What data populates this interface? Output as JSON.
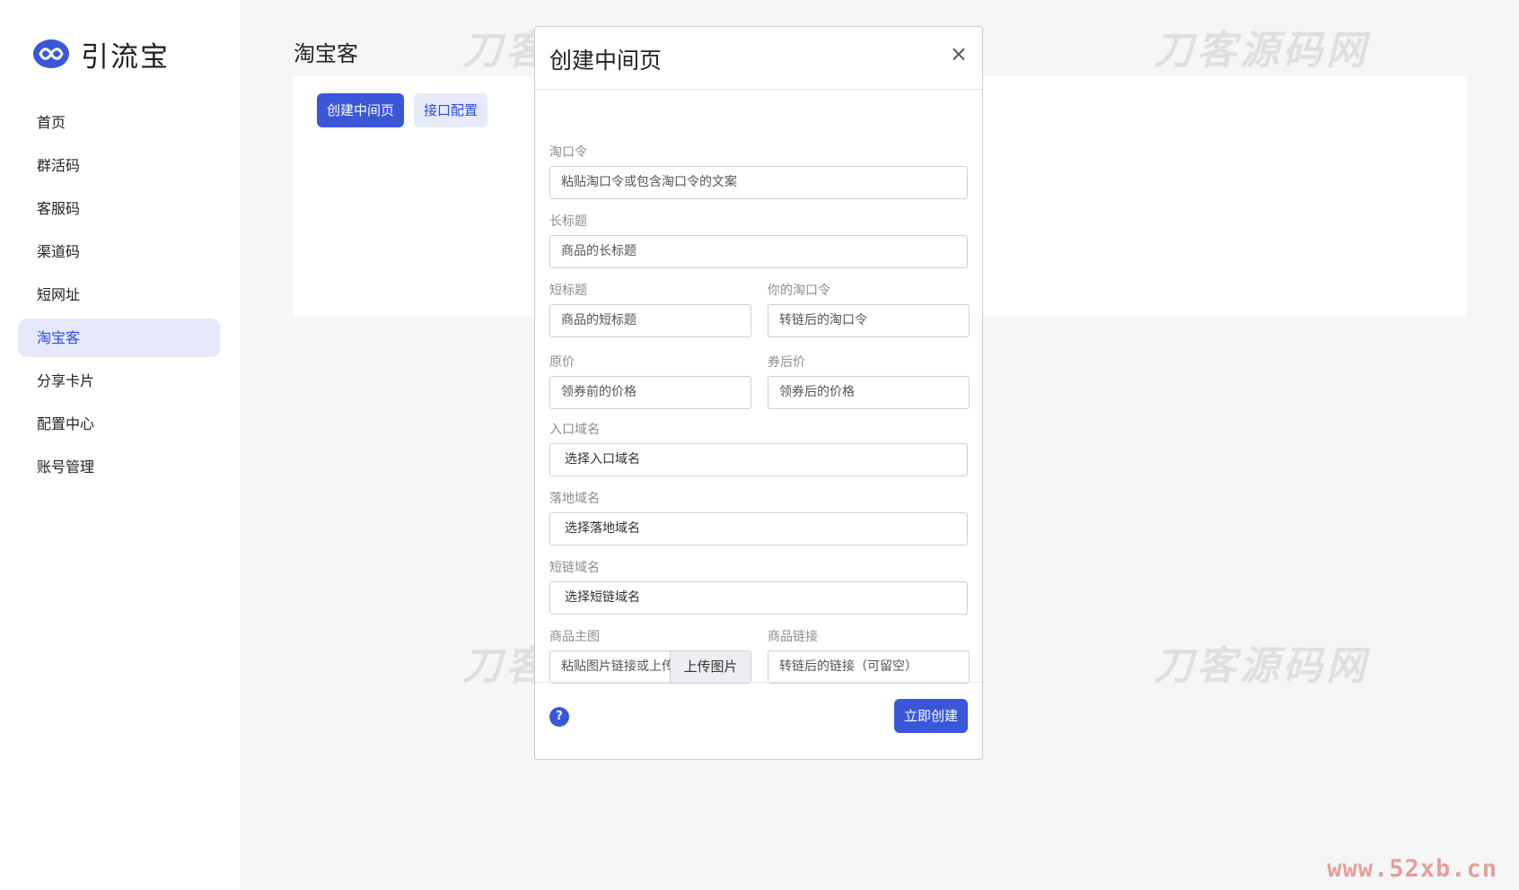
{
  "brand": {
    "name": "引流宝"
  },
  "sidebar": {
    "items": [
      {
        "label": "首页"
      },
      {
        "label": "群活码"
      },
      {
        "label": "客服码"
      },
      {
        "label": "渠道码"
      },
      {
        "label": "短网址"
      },
      {
        "label": "淘宝客",
        "active": true
      },
      {
        "label": "分享卡片"
      },
      {
        "label": "配置中心"
      },
      {
        "label": "账号管理"
      }
    ]
  },
  "main": {
    "title": "淘宝客",
    "buttons": {
      "create": "创建中间页",
      "api_config": "接口配置"
    }
  },
  "modal": {
    "title": "创建中间页",
    "close": "×",
    "fields": {
      "tkl": {
        "label": "淘口令",
        "placeholder": "粘贴淘口令或包含淘口令的文案"
      },
      "long_title": {
        "label": "长标题",
        "placeholder": "商品的长标题"
      },
      "short_title": {
        "label": "短标题",
        "placeholder": "商品的短标题"
      },
      "your_tkl": {
        "label": "你的淘口令",
        "placeholder": "转链后的淘口令"
      },
      "original_price": {
        "label": "原价",
        "placeholder": "领券前的价格"
      },
      "coupon_price": {
        "label": "券后价",
        "placeholder": "领券后的价格"
      },
      "entry_domain": {
        "label": "入口域名",
        "value": "选择入口域名"
      },
      "landing_domain": {
        "label": "落地域名",
        "value": "选择落地域名"
      },
      "short_domain": {
        "label": "短链域名",
        "value": "选择短链域名"
      },
      "main_image": {
        "label": "商品主图",
        "placeholder": "粘贴图片链接或上传",
        "upload_label": "上传图片"
      },
      "product_link": {
        "label": "商品链接",
        "placeholder": "转链后的链接（可留空）"
      }
    },
    "footer": {
      "help": "?",
      "submit": "立即创建"
    }
  },
  "watermarks": {
    "text": "刀客源码网",
    "site": "www.52xb.cn"
  },
  "colors": {
    "primary": "#3a57d9",
    "active_bg": "#e5e9fa",
    "page_bg": "#f5f6f8"
  }
}
